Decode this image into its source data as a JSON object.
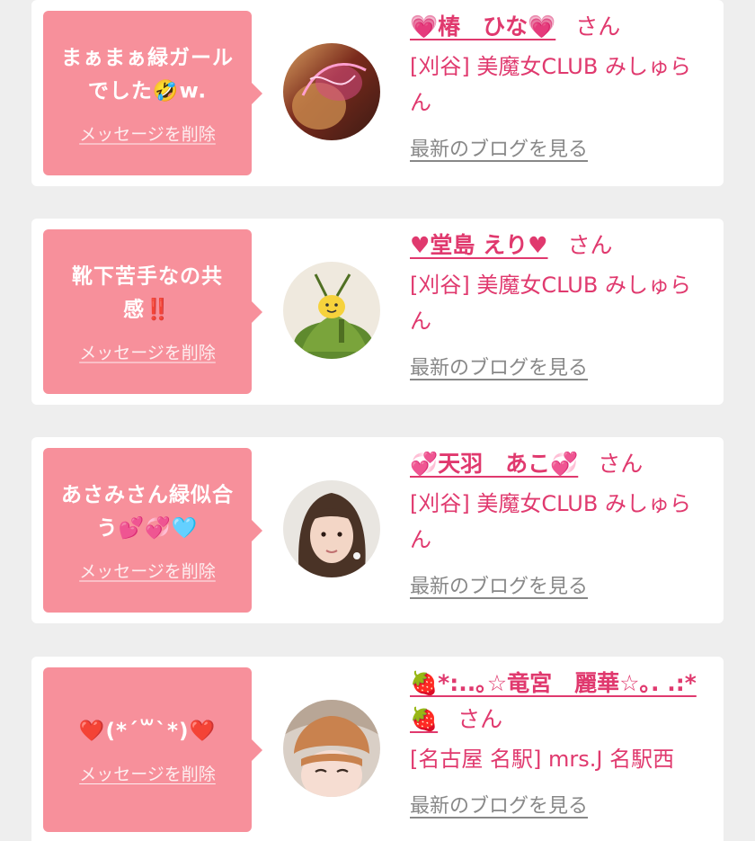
{
  "favorites": [
    {
      "message": "まぁまぁ緑ガールでした🤣w.",
      "delete_label": "メッセージを削除",
      "cast_name": "💗椿　ひな💗",
      "honorific": "さん",
      "shop": "[刈谷] 美魔女CLUB みしゅらん",
      "blog_link": "最新のブログを見る",
      "avatar_icon": "cast-photo-avatar"
    },
    {
      "message": "靴下苦手なの共感‼️",
      "delete_label": "メッセージを削除",
      "cast_name": "♥堂島 えり♥",
      "honorific": "さん",
      "shop": "[刈谷] 美魔女CLUB みしゅらん",
      "blog_link": "最新のブログを見る",
      "avatar_icon": "cast-photo-avatar"
    },
    {
      "message": "あさみさん緑似合う💕💞🩵",
      "delete_label": "メッセージを削除",
      "cast_name": "💞天羽　あこ💞",
      "honorific": "さん",
      "shop": "[刈谷] 美魔女CLUB みしゅらん",
      "blog_link": "最新のブログを見る",
      "avatar_icon": "cast-photo-avatar"
    },
    {
      "message": "❤️(*´꒳`*)❤️",
      "delete_label": "メッセージを削除",
      "cast_name": "🍓*:..｡☆竜宮　麗華☆｡. .:*🍓",
      "honorific": "さん",
      "shop": "[名古屋 名駅] mrs.J 名駅西",
      "blog_link": "最新のブログを見る",
      "avatar_icon": "cast-photo-avatar"
    }
  ],
  "colors": {
    "background": "#eeeeee",
    "bubble": "#f7909b",
    "accent": "#e0396e",
    "link_gray": "#888888"
  }
}
